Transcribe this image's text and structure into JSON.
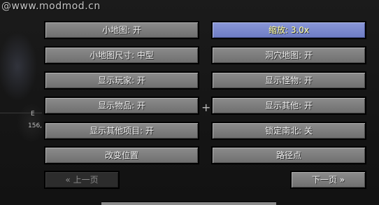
{
  "watermark": "@www.modmod.cn",
  "map_overlay": {
    "coordinate_label": "156,",
    "axis_letter": "E",
    "dots_text": "· · ·"
  },
  "options": {
    "left": [
      {
        "label": "小地图: 开"
      },
      {
        "label": "小地图尺寸: 中型"
      },
      {
        "label": "显示玩家: 开"
      },
      {
        "label": "显示物品: 开"
      },
      {
        "label": "显示其他项目: 开"
      },
      {
        "label": "改变位置"
      }
    ],
    "right": [
      {
        "label": "缩放: 3.0x",
        "state": "hovered"
      },
      {
        "label": "洞穴地图: 开"
      },
      {
        "label": "显示怪物: 开"
      },
      {
        "label": "显示其他: 开"
      },
      {
        "label": "锁定南北: 关"
      },
      {
        "label": "路径点"
      }
    ]
  },
  "navigation": {
    "prev_label": "« 上一页",
    "prev_state": "disabled",
    "next_label": "下一页 »"
  },
  "colors": {
    "button_face": "#7d7d7d",
    "button_hover": "#7c89cf",
    "hover_text": "#ffffa0",
    "disabled_face": "#2c2c2c"
  }
}
